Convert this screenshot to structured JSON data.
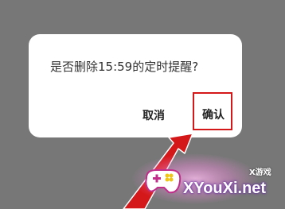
{
  "dialog": {
    "message": "是否删除15:59的定时提醒?",
    "cancel_label": "取消",
    "confirm_label": "确认"
  },
  "annotation": {
    "highlight_color": "#d4181a",
    "arrow_color": "#d4181a"
  },
  "watermark": {
    "brand_label": "X游戏",
    "site_label": "XYouXi.net",
    "logo_icon": "gamepad-icon"
  }
}
